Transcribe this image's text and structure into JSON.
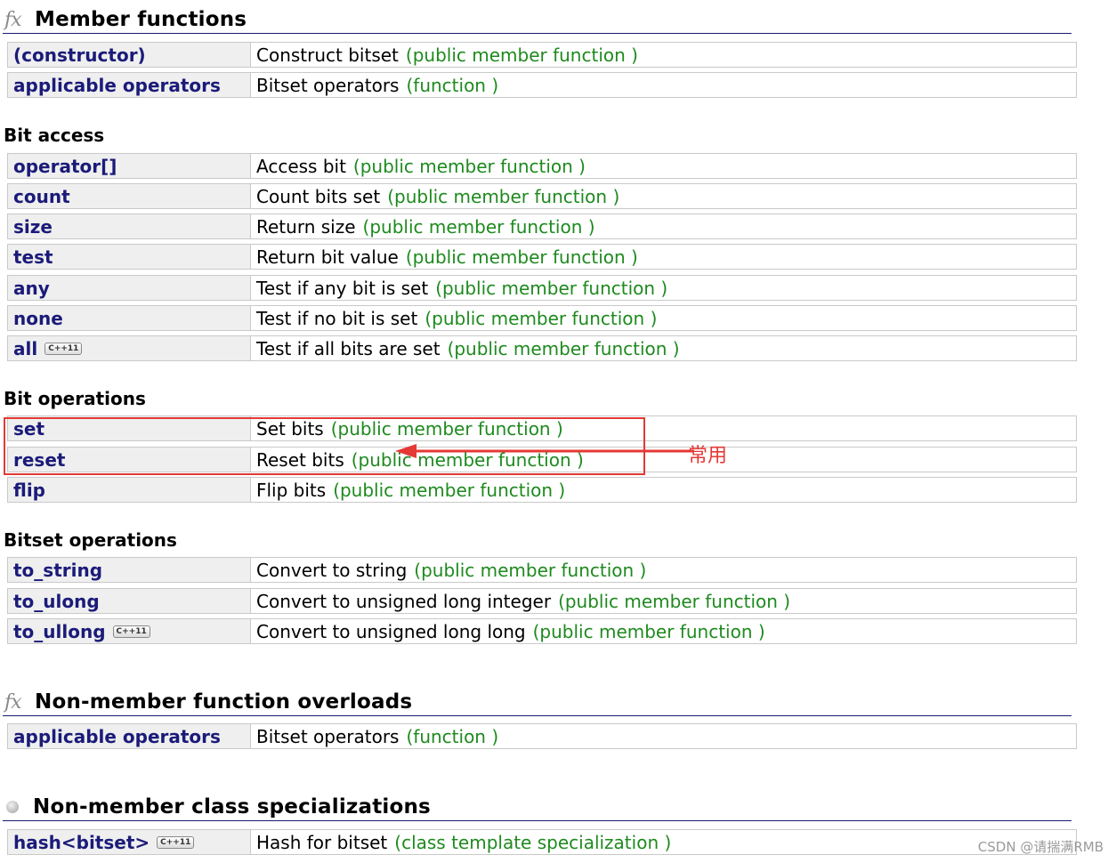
{
  "sections": {
    "member_functions": {
      "icon": "fx-icon",
      "icon_text": "fx",
      "title": "Member functions",
      "rows": [
        {
          "name": "(constructor)",
          "desc": "Construct bitset",
          "kind": "(public member function )"
        },
        {
          "name": "applicable operators",
          "desc": "Bitset operators",
          "kind": "(function )"
        }
      ]
    },
    "non_member_overloads": {
      "icon": "fx-icon",
      "icon_text": "fx",
      "title": "Non-member function overloads",
      "rows": [
        {
          "name": "applicable operators",
          "desc": "Bitset operators",
          "kind": "(function )"
        }
      ]
    },
    "non_member_specializations": {
      "icon": "bullet-icon",
      "title": "Non-member class specializations",
      "rows": [
        {
          "name": "hash<bitset>",
          "badge": "C++11",
          "desc": "Hash for bitset",
          "kind": "(class template specialization )"
        }
      ]
    }
  },
  "groups": {
    "bit_access": {
      "title": "Bit access",
      "rows": [
        {
          "name": "operator[]",
          "desc": "Access bit",
          "kind": "(public member function )"
        },
        {
          "name": "count",
          "desc": "Count bits set",
          "kind": "(public member function )"
        },
        {
          "name": "size",
          "desc": "Return size",
          "kind": "(public member function )"
        },
        {
          "name": "test",
          "desc": "Return bit value",
          "kind": "(public member function )"
        },
        {
          "name": "any",
          "desc": "Test if any bit is set",
          "kind": "(public member function )"
        },
        {
          "name": "none",
          "desc": "Test if no bit is set",
          "kind": "(public member function )"
        },
        {
          "name": "all",
          "badge": "C++11",
          "desc": "Test if all bits are set",
          "kind": "(public member function )"
        }
      ]
    },
    "bit_operations": {
      "title": "Bit operations",
      "rows": [
        {
          "name": "set",
          "desc": "Set bits",
          "kind": "(public member function )"
        },
        {
          "name": "reset",
          "desc": "Reset bits",
          "kind": "(public member function )"
        },
        {
          "name": "flip",
          "desc": "Flip bits",
          "kind": "(public member function )"
        }
      ]
    },
    "bitset_operations": {
      "title": "Bitset operations",
      "rows": [
        {
          "name": "to_string",
          "desc": "Convert to string",
          "kind": "(public member function )"
        },
        {
          "name": "to_ulong",
          "desc": "Convert to unsigned long integer",
          "kind": "(public member function )"
        },
        {
          "name": "to_ullong",
          "badge": "C++11",
          "desc": "Convert to unsigned long long",
          "kind": "(public member function )"
        }
      ]
    }
  },
  "annotation": {
    "label": "常用",
    "color": "#e53935"
  },
  "watermark": "CSDN @请揣满RMB",
  "colors": {
    "link": "#1b1b7a",
    "kind": "#1e8a1e",
    "name_bg": "#efefef",
    "border": "#c9c9c9"
  }
}
